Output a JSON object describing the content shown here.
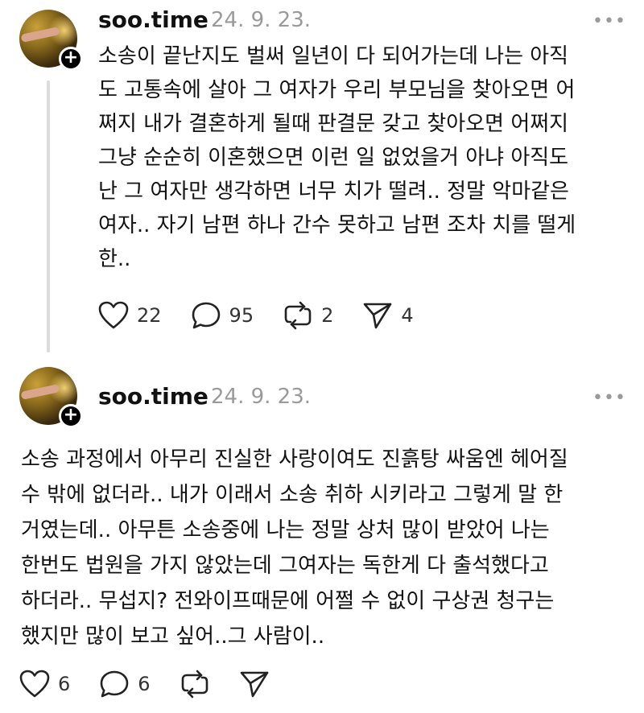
{
  "posts": [
    {
      "username": "soo.time",
      "date": "24. 9. 23.",
      "more_label": "•••",
      "lines": [
        "소송이 끝난지도 벌써 일년이 다 되어가는데 나는 아직",
        "도 고통속에 살아 그 여자가 우리 부모님을 찾아오면 어",
        "쩌지 내가 결혼하게 될때 판결문 갖고 찾아오면 어쩌지",
        "그냥 순순히 이혼했으면 이런 일 없었을거 아냐 아직도",
        "난 그 여자만 생각하면 너무 치가 떨려.. 정말 악마같은",
        "여자.. 자기 남편 하나 간수 못하고 남편 조차 치를 떨게",
        "한.."
      ],
      "likes": "22",
      "comments": "95",
      "reposts": "2",
      "shares": "4"
    },
    {
      "username": "soo.time",
      "date": "24. 9. 23.",
      "more_label": "•••",
      "lines": [
        "소송 과정에서 아무리 진실한 사랑이여도 진흙탕 싸움엔 헤어질",
        "수 밖에 없더라.. 내가 이래서 소송 취하 시키라고 그렇게 말 한",
        "거였는데.. 아무튼 소송중에 나는 정말 상처 많이 받았어 나는",
        "한번도 법원을 가지 않았는데 그여자는 독한게 다 출석했다고",
        "하더라.. 무섭지? 전와이프때문에 어쩔 수 없이 구상권 청구는",
        "했지만 많이 보고 싶어..그 사람이.."
      ],
      "likes": "6",
      "comments": "6"
    }
  ],
  "icons": {
    "plus": "+",
    "like": "heart-icon",
    "comment": "comment-icon",
    "repost": "repost-icon",
    "share": "send-icon"
  }
}
